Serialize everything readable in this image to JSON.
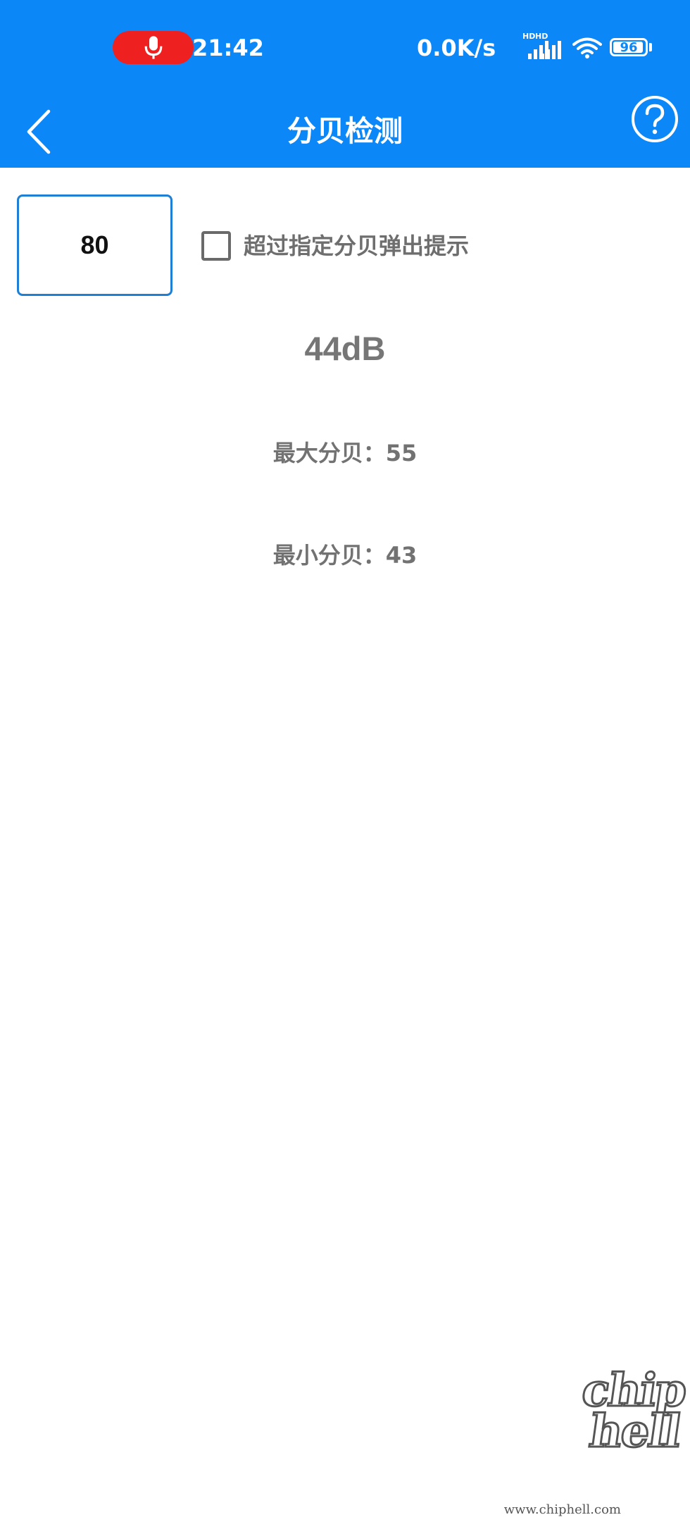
{
  "status_bar": {
    "time": "21:42",
    "net_speed": "0.0K/s",
    "signal_1_badge": "HD",
    "signal_2_badge": "HD",
    "battery_level": "96",
    "recording_icon": "microphone-icon",
    "wifi_icon": "wifi-icon",
    "colors": {
      "background": "#0b87f7",
      "recording_pill": "#ef2020"
    }
  },
  "app_bar": {
    "title": "分贝检测",
    "back_icon": "chevron-left-icon",
    "help_icon": "question-circle-icon"
  },
  "threshold": {
    "value": "80",
    "alert_label": "超过指定分贝弹出提示",
    "alert_checked": false
  },
  "meter": {
    "current": "44dB",
    "max": "最大分贝：55",
    "min": "最小分贝：43"
  },
  "watermark": {
    "logo_line_1": "chip",
    "logo_line_2": "hell",
    "url": "www.chiphell.com"
  }
}
